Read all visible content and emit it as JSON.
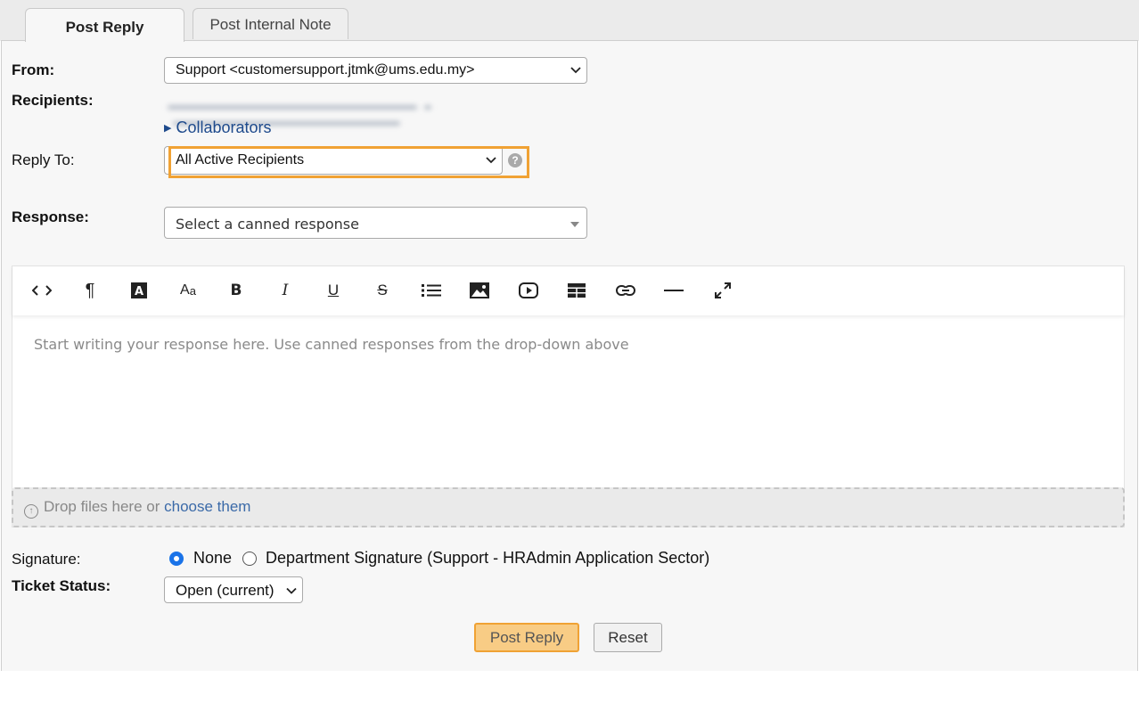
{
  "tabs": [
    {
      "label": "Post Reply",
      "active": true
    },
    {
      "label": "Post Internal Note",
      "active": false
    }
  ],
  "form": {
    "from_label": "From:",
    "from_value": "Support <customersupport.jtmk@ums.edu.my>",
    "recipients_label": "Recipients:",
    "collaborators_label": "Collaborators",
    "reply_to_label": "Reply To:",
    "reply_to_value": "All Active Recipients",
    "response_label": "Response:",
    "response_placeholder": "Select a canned response"
  },
  "editor": {
    "toolbar": [
      {
        "name": "code-view-icon",
        "glyph": "<>"
      },
      {
        "name": "paragraph-format-icon",
        "glyph": "¶"
      },
      {
        "name": "text-color-icon",
        "glyph": "A"
      },
      {
        "name": "font-size-icon",
        "glyph": "Aa"
      },
      {
        "name": "bold-icon",
        "glyph": "B"
      },
      {
        "name": "italic-icon",
        "glyph": "I"
      },
      {
        "name": "underline-icon",
        "glyph": "U"
      },
      {
        "name": "strikethrough-icon",
        "glyph": "S"
      },
      {
        "name": "unordered-list-icon",
        "glyph": "list"
      },
      {
        "name": "image-icon",
        "glyph": "image"
      },
      {
        "name": "video-icon",
        "glyph": "video"
      },
      {
        "name": "table-icon",
        "glyph": "table"
      },
      {
        "name": "link-icon",
        "glyph": "link"
      },
      {
        "name": "horizontal-rule-icon",
        "glyph": "—"
      },
      {
        "name": "fullscreen-icon",
        "glyph": "expand"
      }
    ],
    "placeholder": "Start writing your response here. Use canned responses from the drop-down above",
    "drop_text": "Drop files here or",
    "drop_link": "choose them"
  },
  "signature": {
    "label": "Signature:",
    "options": [
      {
        "label": "None",
        "selected": true
      },
      {
        "label": "Department Signature (Support - HRAdmin Application Sector)",
        "selected": false
      }
    ]
  },
  "status": {
    "label": "Ticket Status:",
    "value": "Open (current)"
  },
  "buttons": {
    "post_reply": "Post Reply",
    "reset": "Reset"
  },
  "colors": {
    "accent": "#f0a234",
    "link": "#1e4a8c",
    "radio": "#1a73e8"
  }
}
